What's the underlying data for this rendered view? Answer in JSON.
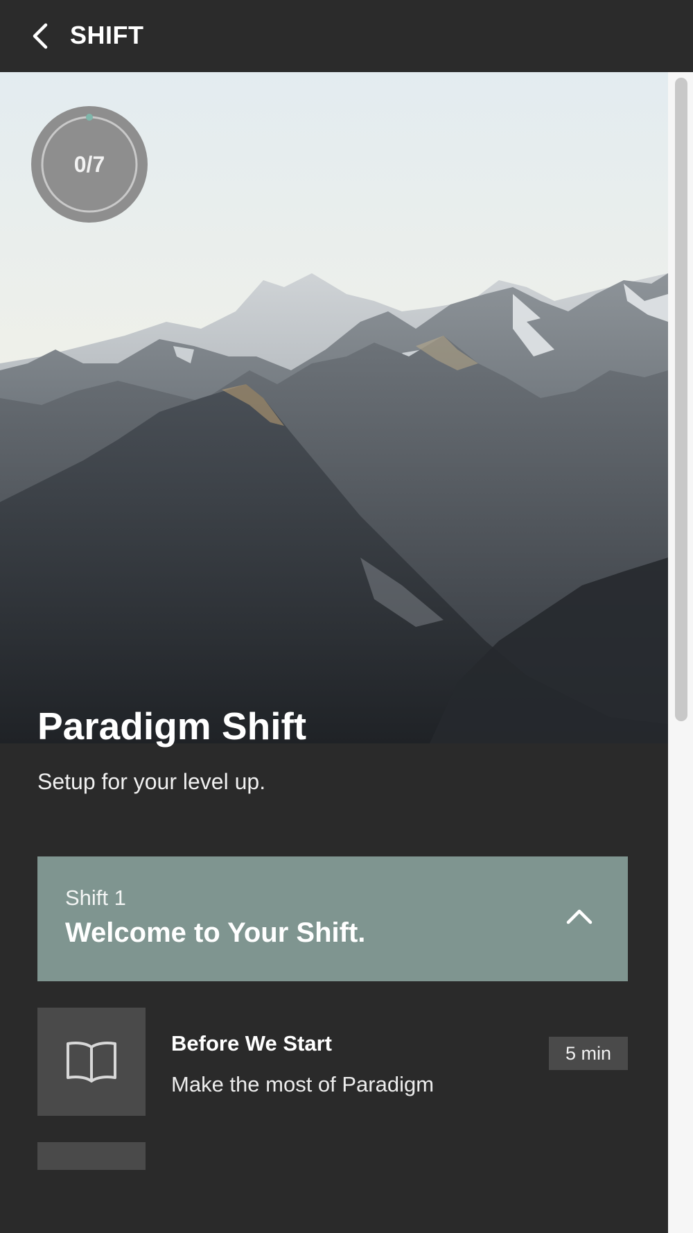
{
  "header": {
    "back_icon": "chevron-left-icon",
    "title": "SHIFT"
  },
  "hero": {
    "image": "mountain-range-photo",
    "progress_label": "0/7",
    "progress_fraction": 0.0,
    "progress_accent": "#7fb7ab"
  },
  "course": {
    "title": "Paradigm Shift",
    "subtitle": "Setup for your level up."
  },
  "section": {
    "label": "Shift 1",
    "title": "Welcome to Your Shift.",
    "toggle_icon": "chevron-up-icon",
    "color": "#7f9590"
  },
  "lessons": [
    {
      "icon": "book-open-icon",
      "title": "Before We Start",
      "description": "Make the most of Paradigm",
      "duration": "5 min"
    }
  ]
}
